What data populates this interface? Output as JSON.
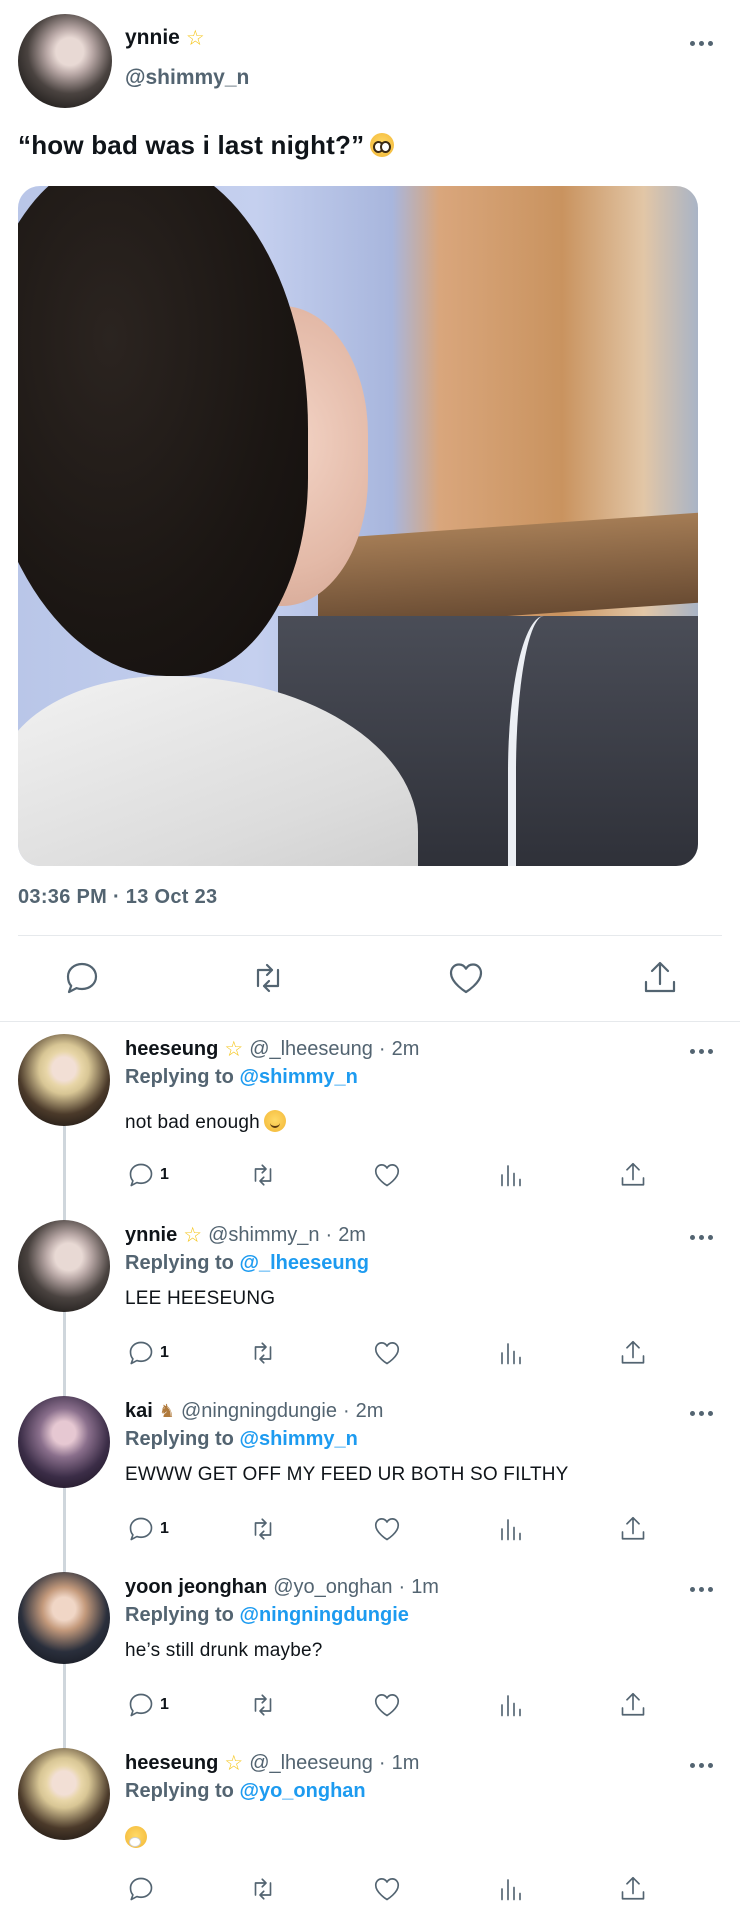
{
  "main_tweet": {
    "author_name": "ynnie",
    "author_handle": "@shimmy_n",
    "text": "“how bad was i last night?”",
    "timestamp": "03:36 PM · 13 Oct 23",
    "image_alt": "photo of a smiling young man with dark hair in a white t-shirt",
    "actions": [
      "reply-icon",
      "retweet-icon",
      "like-icon",
      "share-icon"
    ]
  },
  "replies": [
    {
      "name": "heeseung",
      "handle": "@_lheeseung",
      "time": "2m",
      "replying_label": "Replying to",
      "replying_to": "@shimmy_n",
      "text": "not bad enough",
      "reply_count": "1"
    },
    {
      "name": "ynnie",
      "handle": "@shimmy_n",
      "time": "2m",
      "replying_label": "Replying to",
      "replying_to": "@_lheeseung",
      "text": "LEE HEESEUNG",
      "reply_count": "1"
    },
    {
      "name": "kai",
      "handle": "@ningningdungie",
      "time": "2m",
      "replying_label": "Replying to",
      "replying_to": "@shimmy_n",
      "text": "EWWW GET OFF MY FEED UR BOTH SO FILTHY",
      "reply_count": "1"
    },
    {
      "name": "yoon jeonghan",
      "handle": "@yo_onghan",
      "time": "1m",
      "replying_label": "Replying to",
      "replying_to": "@ningningdungie",
      "text": "he’s still drunk maybe?",
      "reply_count": "1"
    },
    {
      "name": "heeseung",
      "handle": "@_lheeseung",
      "time": "1m",
      "replying_label": "Replying to",
      "replying_to": "@yo_onghan",
      "text": "",
      "reply_count": ""
    }
  ],
  "separator": "·",
  "colors": {
    "link": "#1d9bf0",
    "muted": "#536471",
    "text": "#0f1419",
    "divider": "#e6e9ec"
  }
}
